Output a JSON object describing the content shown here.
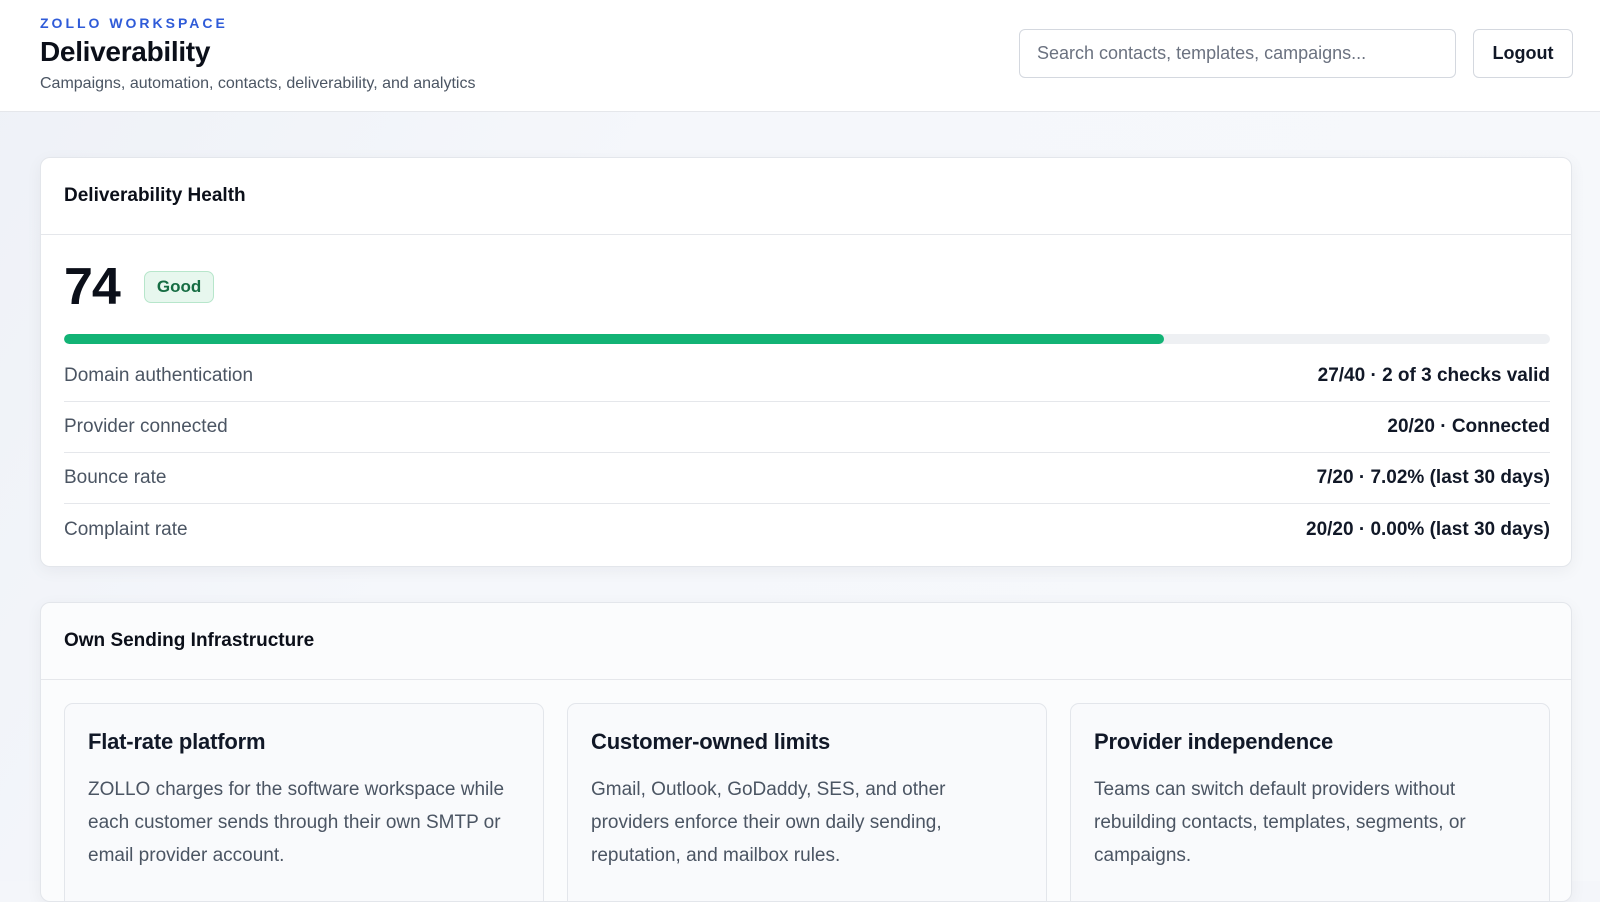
{
  "header": {
    "brand": "ZOLLO WORKSPACE",
    "title": "Deliverability",
    "subtitle": "Campaigns, automation, contacts, deliverability, and analytics",
    "search_placeholder": "Search contacts, templates, campaigns...",
    "logout_label": "Logout"
  },
  "health": {
    "title": "Deliverability Health",
    "score": "74",
    "score_value": 74,
    "score_max": 100,
    "status_badge": "Good",
    "progress_color": "#12b375",
    "metrics": [
      {
        "label": "Domain authentication",
        "value": "27/40 · 2 of 3 checks valid"
      },
      {
        "label": "Provider connected",
        "value": "20/20 · Connected"
      },
      {
        "label": "Bounce rate",
        "value": "7/20 · 7.02% (last 30 days)"
      },
      {
        "label": "Complaint rate",
        "value": "20/20 · 0.00% (last 30 days)"
      }
    ]
  },
  "infrastructure": {
    "title": "Own Sending Infrastructure",
    "features": [
      {
        "title": "Flat-rate platform",
        "body": "ZOLLO charges for the software workspace while each customer sends through their own SMTP or email provider account."
      },
      {
        "title": "Customer-owned limits",
        "body": "Gmail, Outlook, GoDaddy, SES, and other providers enforce their own daily sending, reputation, and mailbox rules."
      },
      {
        "title": "Provider independence",
        "body": "Teams can switch default providers without rebuilding contacts, templates, segments, or campaigns."
      }
    ]
  },
  "colors": {
    "brand_accent": "#2f5bd8",
    "badge_good_bg": "#e7f7ee",
    "badge_good_text": "#166d43"
  }
}
